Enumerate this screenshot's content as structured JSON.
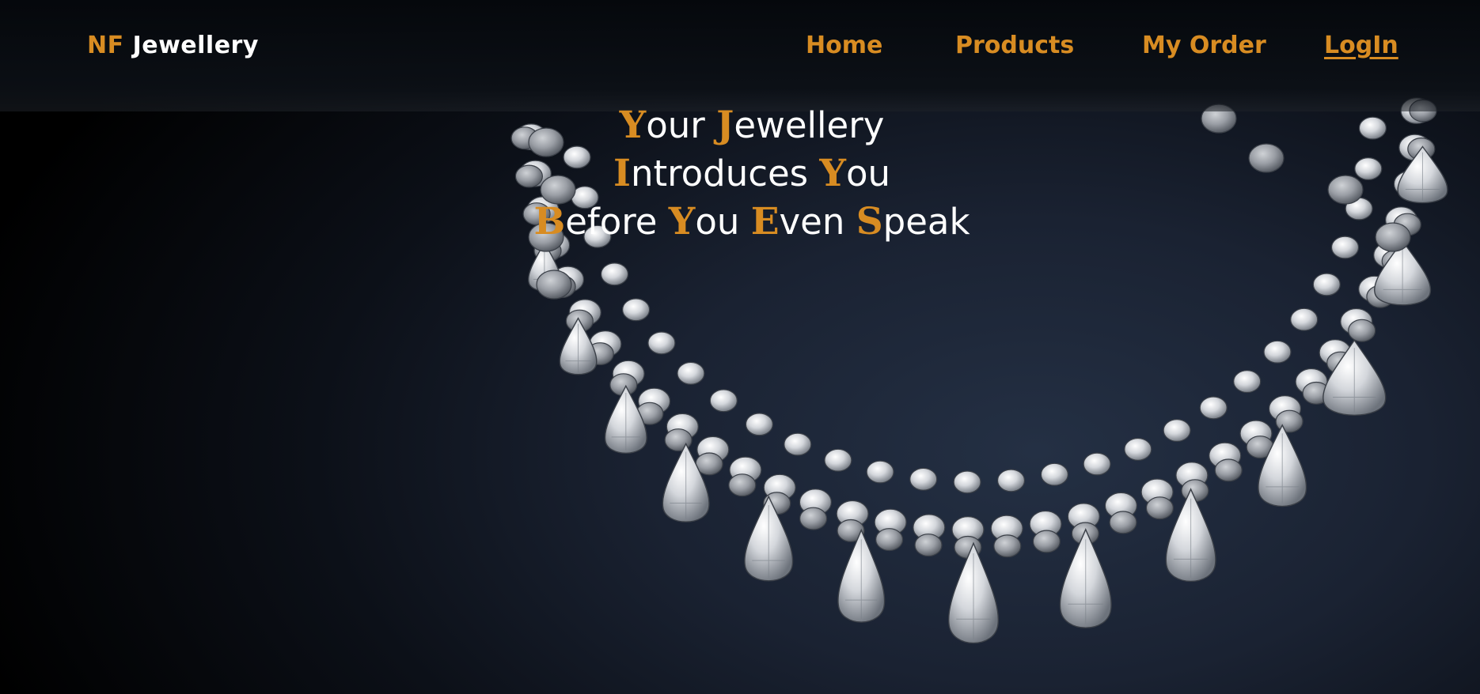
{
  "colors": {
    "accent": "#d88c22",
    "text": "#ffffff",
    "background": "#0c1018",
    "gem": "#d4d7dc"
  },
  "brand": {
    "accent": "NF",
    "main": "Jewellery"
  },
  "nav": {
    "home": "Home",
    "products": "Products",
    "my_order": "My Order",
    "login": "LogIn"
  },
  "hero": {
    "lines": [
      [
        {
          "cap": "Y",
          "rest": "our"
        },
        {
          "cap": "J",
          "rest": "ewellery"
        }
      ],
      [
        {
          "cap": "I",
          "rest": "ntroduces"
        },
        {
          "cap": "Y",
          "rest": "ou"
        }
      ],
      [
        {
          "cap": "B",
          "rest": "efore"
        },
        {
          "cap": "Y",
          "rest": "ou"
        },
        {
          "cap": "E",
          "rest": "ven"
        },
        {
          "cap": "S",
          "rest": "peak"
        }
      ]
    ]
  },
  "image": {
    "icon": "diamond-necklace-image"
  }
}
